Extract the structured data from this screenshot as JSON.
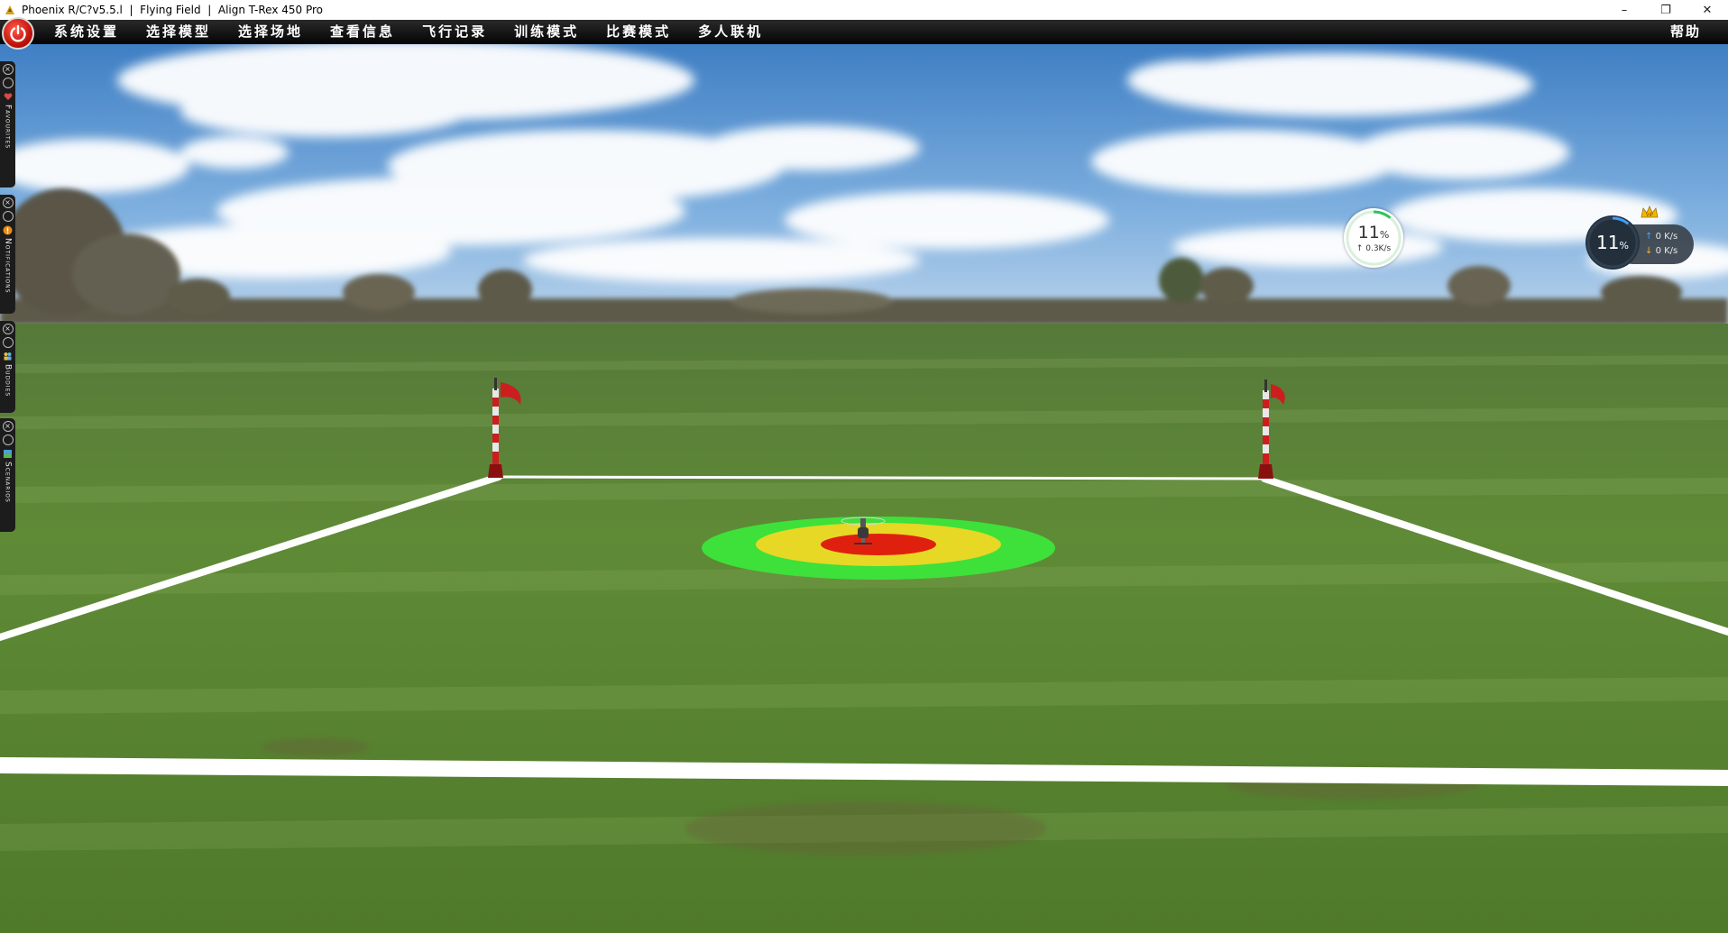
{
  "window": {
    "title": "Phoenix R/C?v5.5.l  |  Flying Field  |  Align T-Rex 450 Pro",
    "controls": {
      "minimize": "–",
      "restore": "❐",
      "close": "✕"
    }
  },
  "menubar": {
    "items": [
      "系统设置",
      "选择模型",
      "选择场地",
      "查看信息",
      "飞行记录",
      "训练模式",
      "比赛模式",
      "多人联机"
    ],
    "help": "帮助"
  },
  "side_panels": [
    {
      "label": "Favourites"
    },
    {
      "label": "Notifications"
    },
    {
      "label": "Buddies"
    },
    {
      "label": "Scenarios"
    }
  ],
  "net_widget_small": {
    "percent": "11",
    "percent_unit": "%",
    "speed": "↑ 0.3K/s"
  },
  "net_widget_big": {
    "percent": "11",
    "percent_unit": "%",
    "up": "0 K/s",
    "down": "0 K/s"
  },
  "colors": {
    "menubar": "#111111",
    "target_outer": "#3ee03a",
    "target_mid": "#e6d825",
    "target_inner": "#e0200f",
    "boundary": "#ffffff",
    "flag": "#cc1e1e"
  }
}
